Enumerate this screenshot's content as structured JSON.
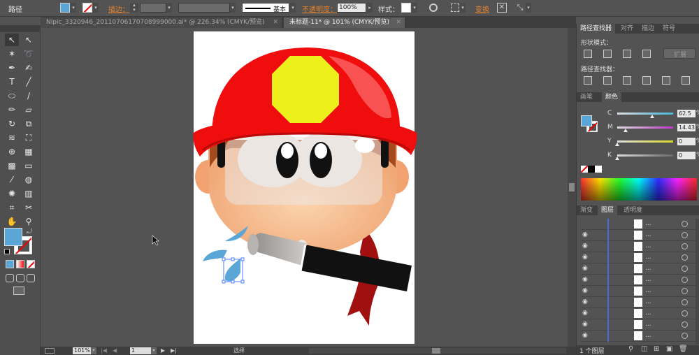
{
  "control_bar": {
    "path_label": "路径",
    "stroke_label": "描边：",
    "stroke_style": "基本",
    "opacity_label": "不透明度：",
    "opacity_value": "100%",
    "style_label": "样式：",
    "transform_label": "变换"
  },
  "doc_tabs": [
    {
      "label": "Nipic_3320946_20110706170708999000.ai* @ 226.34% (CMYK/预览)"
    },
    {
      "label": "未标题-11* @ 101% (CMYK/预览)"
    }
  ],
  "status": {
    "zoom": "101%",
    "page": "1",
    "mode": "选择"
  },
  "pathfinder_panel": {
    "tabs": [
      "路径查找器",
      "对齐",
      "描边",
      "符号"
    ],
    "shape_modes_label": "形状模式：",
    "expand_label": "扩展",
    "pathfinders_label": "路径查找器："
  },
  "color_panel": {
    "tabs": [
      "画笔",
      "颜色"
    ],
    "channels": [
      {
        "name": "C",
        "value": "62.5",
        "fraction": 0.625,
        "color": "#48b4d8"
      },
      {
        "name": "M",
        "value": "14.43",
        "fraction": 0.1443,
        "color": "#c03cc8"
      },
      {
        "name": "Y",
        "value": "0",
        "fraction": 0.0,
        "color": "#d8d828"
      },
      {
        "name": "K",
        "value": "0",
        "fraction": 0.0,
        "color": "#6a6a6a"
      }
    ],
    "percent_sign": "%",
    "fill_color": "#5aa6d6"
  },
  "layers_panel": {
    "tabs": [
      "渐变",
      "图层",
      "透明度"
    ],
    "rows": [
      {
        "name": "..."
      },
      {
        "name": "..."
      },
      {
        "name": "..."
      },
      {
        "name": "..."
      },
      {
        "name": "..."
      },
      {
        "name": "..."
      },
      {
        "name": "..."
      },
      {
        "name": "..."
      },
      {
        "name": "..."
      },
      {
        "name": "..."
      },
      {
        "name": "..."
      }
    ],
    "footer": "1 个图层"
  },
  "colors": {
    "helmet": "#f00d0d",
    "badge": "#eef01c",
    "skin": "#f3b98c",
    "goggles": "#ece6e2",
    "hose": "#111111",
    "nozzle": "#b7b3b0",
    "scarf": "#a01010",
    "water": "#5aa6d6"
  }
}
